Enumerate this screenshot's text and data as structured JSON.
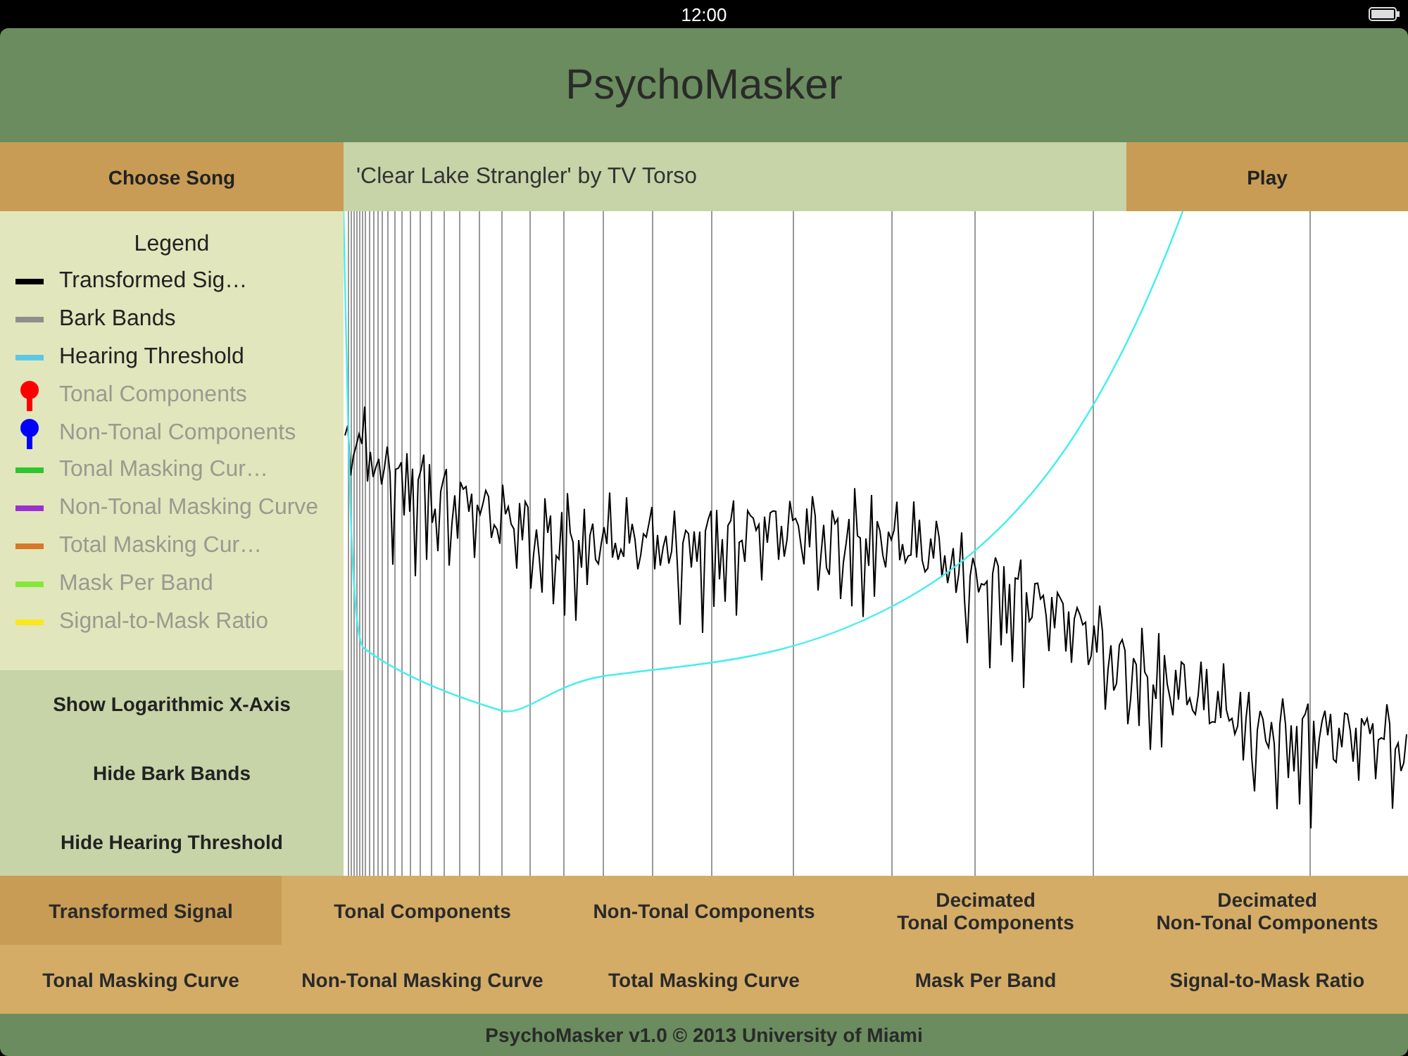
{
  "status_bar": {
    "time": "12:00"
  },
  "window": {
    "title": "PsychoMasker"
  },
  "toolbar": {
    "choose_button": "Choose Song",
    "song": "'Clear Lake Strangler' by TV Torso",
    "play_button": "Play"
  },
  "legend": {
    "title": "Legend",
    "items": [
      {
        "label": "Transformed Sig…",
        "kind": "line",
        "color": "#000000",
        "enabled": true
      },
      {
        "label": "Bark Bands",
        "kind": "line",
        "color": "#8e8e8e",
        "enabled": true
      },
      {
        "label": "Hearing Threshold",
        "kind": "line",
        "color": "#5bc8e4",
        "enabled": true
      },
      {
        "label": "Tonal Components",
        "kind": "pin",
        "color": "#ff0000",
        "enabled": false
      },
      {
        "label": "Non-Tonal Components",
        "kind": "pin",
        "color": "#0000ff",
        "enabled": false
      },
      {
        "label": "Tonal Masking Cur…",
        "kind": "line",
        "color": "#2ec52e",
        "enabled": false
      },
      {
        "label": "Non-Tonal Masking Curve",
        "kind": "line",
        "color": "#9b30d0",
        "enabled": false
      },
      {
        "label": "Total Masking Cur…",
        "kind": "line",
        "color": "#d8782a",
        "enabled": false
      },
      {
        "label": "Mask Per Band",
        "kind": "line",
        "color": "#84e83a",
        "enabled": false
      },
      {
        "label": "Signal-to-Mask Ratio",
        "kind": "line",
        "color": "#f8e81c",
        "enabled": false
      }
    ]
  },
  "side_buttons": [
    "Show Logarithmic X-Axis",
    "Hide Bark Bands",
    "Hide Hearing Threshold"
  ],
  "view_buttons": [
    [
      {
        "label": "Transformed Signal",
        "selected": true
      },
      {
        "label": "Tonal Components",
        "selected": false
      },
      {
        "label": "Non-Tonal Components",
        "selected": false
      },
      {
        "label": "Decimated\nTonal Components",
        "selected": false
      },
      {
        "label": "Decimated\nNon-Tonal Components",
        "selected": false
      }
    ],
    [
      {
        "label": "Tonal Masking Curve",
        "selected": false
      },
      {
        "label": "Non-Tonal Masking Curve",
        "selected": false
      },
      {
        "label": "Total Masking Curve",
        "selected": false
      },
      {
        "label": "Mask Per Band",
        "selected": false
      },
      {
        "label": "Signal-to-Mask Ratio",
        "selected": false
      }
    ]
  ],
  "footer": "PsychoMasker v1.0 © 2013 University of Miami"
}
